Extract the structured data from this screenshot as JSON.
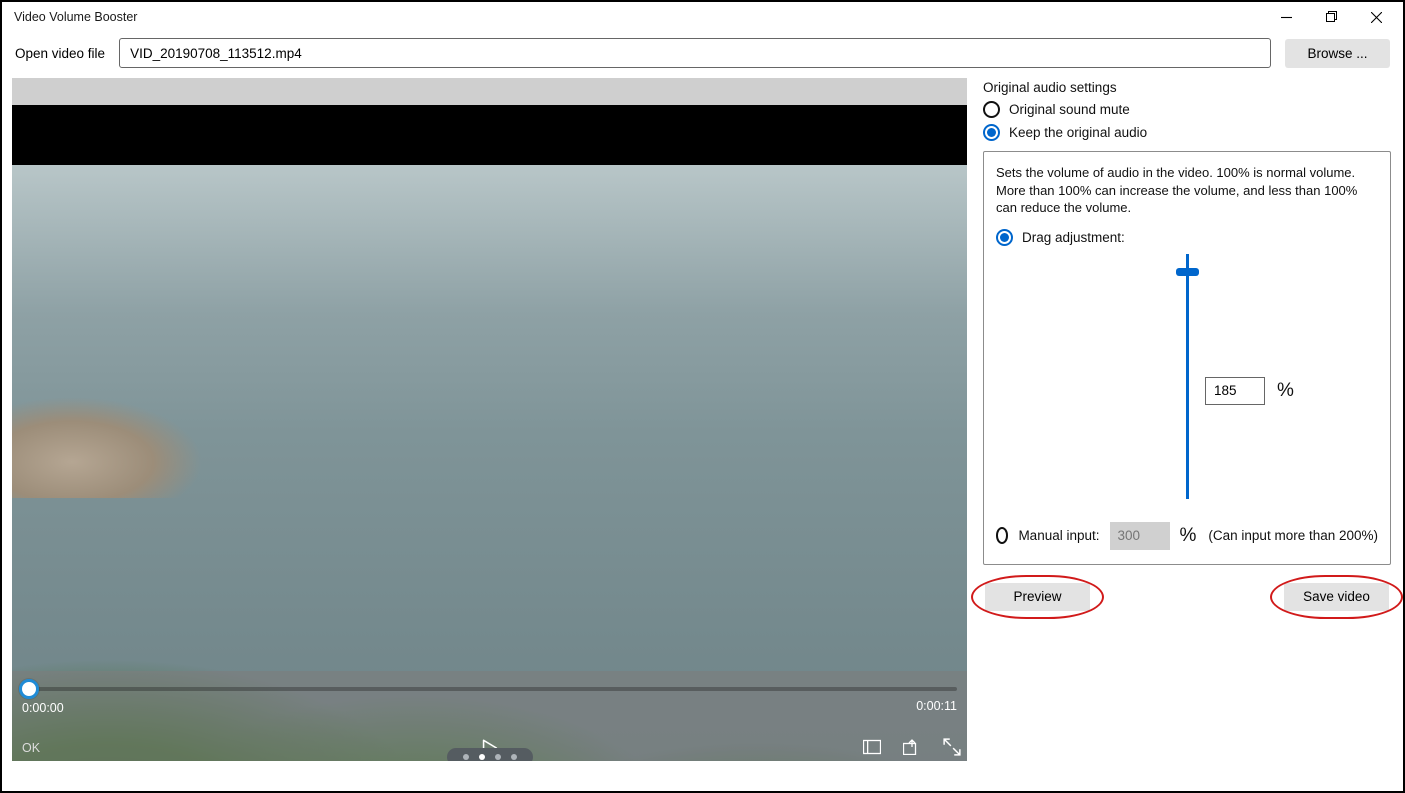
{
  "titlebar": {
    "title": "Video Volume Booster"
  },
  "file": {
    "label": "Open video file",
    "value": "VID_20190708_113512.mp4",
    "browse": "Browse ..."
  },
  "player": {
    "time_current": "0:00:00",
    "time_duration": "0:00:11",
    "ok_label": "OK"
  },
  "settings": {
    "heading": "Original audio settings",
    "opt_mute": "Original sound mute",
    "opt_keep": "Keep the original audio",
    "desc": "Sets the volume of audio in the video. 100% is normal volume. More than 100% can increase the volume, and less than 100% can reduce the volume.",
    "drag_label": "Drag adjustment:",
    "drag_value": "185",
    "percent_sign": "%",
    "manual_label": "Manual input:",
    "manual_placeholder": "300",
    "manual_percent": "%",
    "manual_hint": "(Can input more than 200%)",
    "preview": "Preview",
    "save": "Save video"
  }
}
